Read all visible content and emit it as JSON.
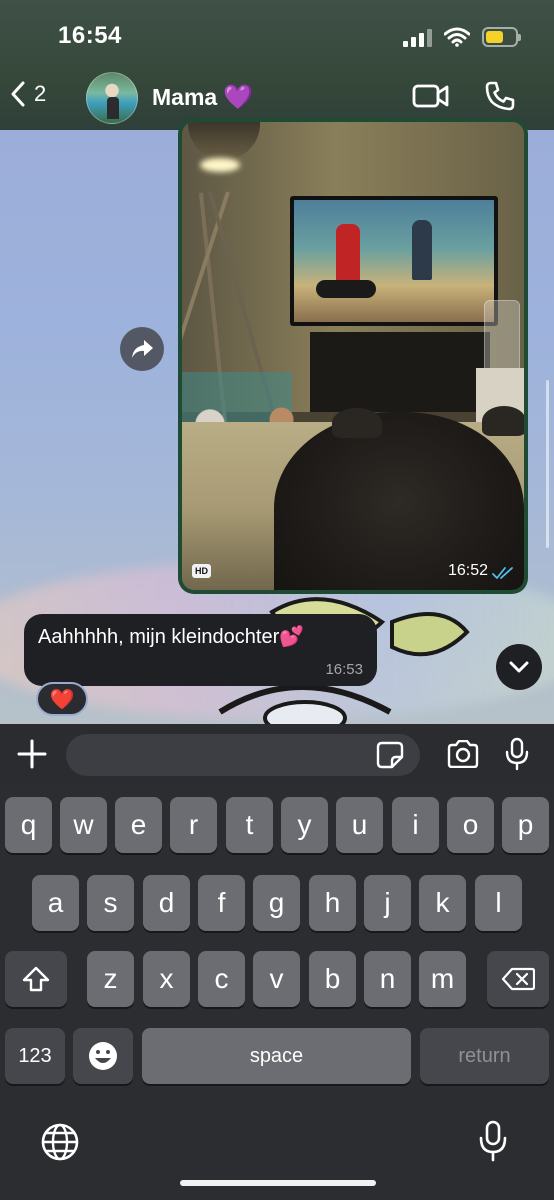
{
  "status": {
    "time": "16:54"
  },
  "header": {
    "back_count": "2",
    "contact_name": "Mama",
    "contact_emoji": "💜"
  },
  "messages": [
    {
      "type": "image",
      "badge": "HD",
      "time": "16:52",
      "status": "read"
    },
    {
      "type": "text",
      "text": "Aahhhhh, mijn kleindochter",
      "emoji": "💕",
      "time": "16:53",
      "reaction": "❤️"
    }
  ],
  "composer": {
    "placeholder": ""
  },
  "keyboard": {
    "row1": [
      "q",
      "w",
      "e",
      "r",
      "t",
      "y",
      "u",
      "i",
      "o",
      "p"
    ],
    "row2": [
      "a",
      "s",
      "d",
      "f",
      "g",
      "h",
      "j",
      "k",
      "l"
    ],
    "row3": [
      "z",
      "x",
      "c",
      "v",
      "b",
      "n",
      "m"
    ],
    "numbers_label": "123",
    "space_label": "space",
    "return_label": "return"
  },
  "colors": {
    "header_bg": "#364839",
    "image_bubble": "#1f4a34",
    "text_bubble": "#1f2024",
    "battery": "#f4d22a",
    "read_ticks": "#53bdeb",
    "keyboard_bg": "#2b2d31"
  },
  "icons": {
    "back": "chevron-left-icon",
    "video": "video-camera-icon",
    "call": "phone-icon",
    "forward": "forward-icon",
    "scroll": "chevron-down-icon",
    "plus": "plus-icon",
    "sticker": "sticker-icon",
    "camera": "camera-icon",
    "mic": "microphone-icon",
    "globe": "globe-icon",
    "emoji": "emoji-icon",
    "shift": "shift-icon",
    "delete": "delete-icon"
  }
}
